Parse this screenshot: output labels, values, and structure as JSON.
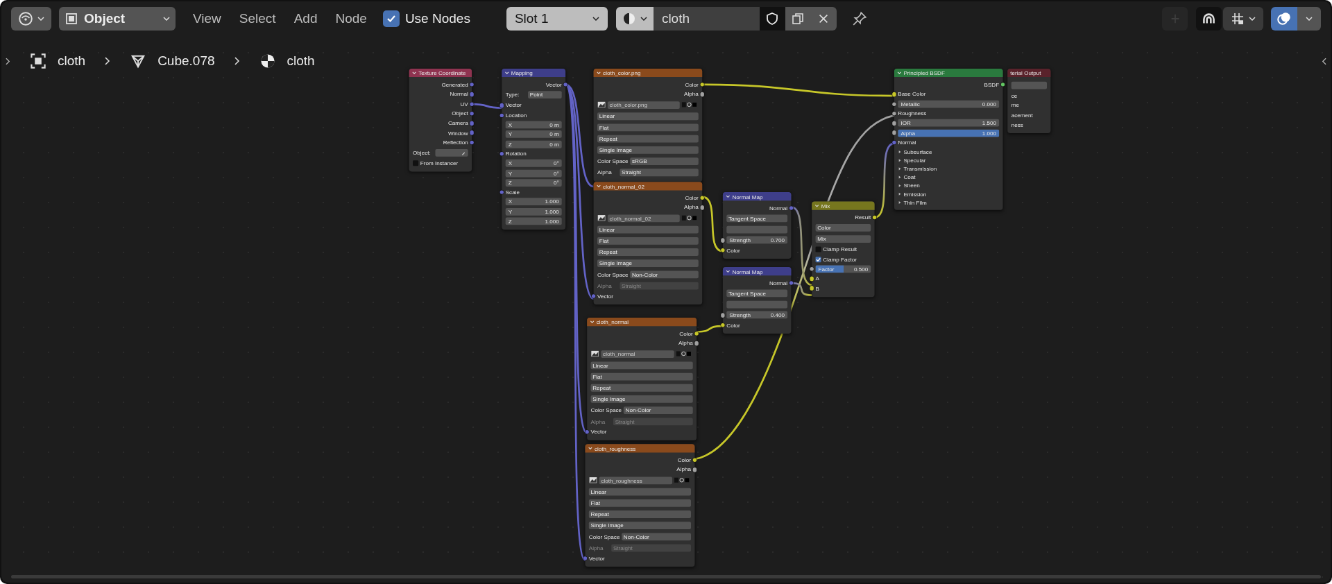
{
  "header": {
    "mode": "Object",
    "menus": [
      "View",
      "Select",
      "Add",
      "Node"
    ],
    "use_nodes": {
      "label": "Use Nodes",
      "checked": true
    },
    "slot": "Slot 1",
    "material": "cloth",
    "overlays_on": true
  },
  "breadcrumbs": [
    {
      "kind": "object",
      "label": "cloth"
    },
    {
      "kind": "mesh",
      "label": "Cube.078"
    },
    {
      "kind": "material",
      "label": "cloth"
    }
  ],
  "nodes": [
    {
      "kind": "input",
      "title": "Texture Coordinate",
      "rows": [
        {
          "kind": "out",
          "label": "Generated",
          "color": "#6363c7"
        },
        {
          "kind": "out",
          "label": "Normal",
          "color": "#6363c7"
        },
        {
          "kind": "out",
          "label": "UV",
          "color": "#6363c7"
        },
        {
          "kind": "out",
          "label": "Object",
          "color": "#6363c7"
        },
        {
          "kind": "out",
          "label": "Camera",
          "color": "#6363c7"
        },
        {
          "kind": "out",
          "label": "Window",
          "color": "#6363c7"
        },
        {
          "kind": "out",
          "label": "Reflection",
          "color": "#6363c7"
        },
        {
          "kind": "object",
          "label": "Object:"
        },
        {
          "kind": "check",
          "label": "From Instancer",
          "checked": false
        }
      ]
    },
    {
      "kind": "vector",
      "title": "Mapping",
      "rows": [
        {
          "kind": "out",
          "label": "Vector",
          "color": "#6363c7"
        },
        {
          "kind": "labeled-select",
          "label": "Type:",
          "value": "Point",
          "disabled": false
        },
        {
          "kind": "in",
          "label": "Vector",
          "color": "#6363c7"
        },
        {
          "kind": "in",
          "label": "Location",
          "color": "#6363c7"
        },
        {
          "kind": "num",
          "label": "X",
          "value": "0 m"
        },
        {
          "kind": "num",
          "label": "Y",
          "value": "0 m"
        },
        {
          "kind": "num",
          "label": "Z",
          "value": "0 m"
        },
        {
          "kind": "in",
          "label": "Rotation",
          "color": "#6363c7"
        },
        {
          "kind": "num",
          "label": "X",
          "value": "0°"
        },
        {
          "kind": "num",
          "label": "Y",
          "value": "0°"
        },
        {
          "kind": "num",
          "label": "Z",
          "value": "0°"
        },
        {
          "kind": "in",
          "label": "Scale",
          "color": "#6363c7"
        },
        {
          "kind": "num",
          "label": "X",
          "value": "1.000"
        },
        {
          "kind": "num",
          "label": "Y",
          "value": "1.000"
        },
        {
          "kind": "num",
          "label": "Z",
          "value": "1.000"
        }
      ]
    },
    {
      "kind": "texture",
      "title": "cloth_color.png",
      "rows": [
        {
          "kind": "out",
          "label": "Color",
          "color": "#c7c729"
        },
        {
          "kind": "out",
          "label": "Alpha",
          "color": "#a1a1a1"
        },
        {
          "kind": "image",
          "value": "cloth_color.png"
        },
        {
          "kind": "select",
          "value": "Linear"
        },
        {
          "kind": "select",
          "value": "Flat"
        },
        {
          "kind": "select",
          "value": "Repeat"
        },
        {
          "kind": "select",
          "value": "Single Image"
        },
        {
          "kind": "labeled-select",
          "label": "Color Space",
          "value": "sRGB",
          "disabled": false
        },
        {
          "kind": "labeled-select",
          "label": "Alpha",
          "value": "Straight",
          "disabled": false
        }
      ]
    },
    {
      "kind": "texture",
      "title": "cloth_normal_02",
      "rows": [
        {
          "kind": "out",
          "label": "Color",
          "color": "#c7c729"
        },
        {
          "kind": "out",
          "label": "Alpha",
          "color": "#a1a1a1"
        },
        {
          "kind": "image",
          "value": "cloth_normal_02"
        },
        {
          "kind": "select",
          "value": "Linear"
        },
        {
          "kind": "select",
          "value": "Flat"
        },
        {
          "kind": "select",
          "value": "Repeat"
        },
        {
          "kind": "select",
          "value": "Single Image"
        },
        {
          "kind": "labeled-select",
          "label": "Color Space",
          "value": "Non-Color",
          "disabled": false
        },
        {
          "kind": "labeled-select",
          "label": "Alpha",
          "value": "Straight",
          "disabled": true
        },
        {
          "kind": "in",
          "label": "Vector",
          "color": "#6363c7"
        }
      ]
    },
    {
      "kind": "vector",
      "title": "Normal Map",
      "rows": [
        {
          "kind": "out",
          "label": "Normal",
          "color": "#6363c7"
        },
        {
          "kind": "select",
          "value": "Tangent Space"
        },
        {
          "kind": "uv-map"
        },
        {
          "kind": "num",
          "label": "Strength",
          "value": "0.700",
          "color": "#a1a1a1"
        },
        {
          "kind": "in",
          "label": "Color",
          "color": "#c7c729"
        }
      ]
    },
    {
      "kind": "vector",
      "title": "Normal Map",
      "rows": [
        {
          "kind": "out",
          "label": "Normal",
          "color": "#6363c7"
        },
        {
          "kind": "select",
          "value": "Tangent Space"
        },
        {
          "kind": "uv-map"
        },
        {
          "kind": "num",
          "label": "Strength",
          "value": "0.400",
          "color": "#a1a1a1"
        },
        {
          "kind": "in",
          "label": "Color",
          "color": "#c7c729"
        }
      ]
    },
    {
      "kind": "color",
      "title": "Mix",
      "rows": [
        {
          "kind": "out",
          "label": "Result",
          "color": "#c7c729"
        },
        {
          "kind": "select",
          "value": "Color"
        },
        {
          "kind": "select",
          "value": "Mix"
        },
        {
          "kind": "check",
          "label": "Clamp Result",
          "checked": false
        },
        {
          "kind": "check",
          "label": "Clamp Factor",
          "checked": true
        },
        {
          "kind": "slider",
          "label": "Factor",
          "value": "0.500",
          "level": 0.5,
          "color": "#a1a1a1"
        },
        {
          "kind": "in",
          "label": "A",
          "color": "#c7c729"
        },
        {
          "kind": "in",
          "label": "B",
          "color": "#c7c729"
        }
      ]
    },
    {
      "kind": "shader",
      "title": "Principled BSDF",
      "rows": [
        {
          "kind": "out",
          "label": "BSDF",
          "color": "#63c763"
        },
        {
          "kind": "in",
          "label": "Base Color",
          "color": "#c7c729"
        },
        {
          "kind": "num",
          "label": "Metallic",
          "value": "0.000",
          "color": "#a1a1a1"
        },
        {
          "kind": "in",
          "label": "Roughness",
          "color": "#a1a1a1"
        },
        {
          "kind": "num",
          "label": "IOR",
          "value": "1.500",
          "color": "#a1a1a1"
        },
        {
          "kind": "slider",
          "label": "Alpha",
          "value": "1.000",
          "level": 1,
          "color": "#a1a1a1"
        },
        {
          "kind": "in",
          "label": "Normal",
          "color": "#6363c7"
        },
        {
          "kind": "panel",
          "label": "Subsurface"
        },
        {
          "kind": "panel",
          "label": "Specular"
        },
        {
          "kind": "panel",
          "label": "Transmission"
        },
        {
          "kind": "panel",
          "label": "Coat"
        },
        {
          "kind": "panel",
          "label": "Sheen"
        },
        {
          "kind": "panel",
          "label": "Emission"
        },
        {
          "kind": "panel",
          "label": "Thin Film"
        }
      ]
    },
    {
      "kind": "output",
      "title": "terial Output",
      "rows": [
        {
          "kind": "blank-select"
        },
        {
          "kind": "cut",
          "label": "ce"
        },
        {
          "kind": "cut",
          "label": "me"
        },
        {
          "kind": "cut",
          "label": "acement"
        },
        {
          "kind": "cut",
          "label": "ness"
        }
      ]
    },
    {
      "kind": "texture",
      "title": "cloth_normal",
      "rows": [
        {
          "kind": "out",
          "label": "Color",
          "color": "#c7c729"
        },
        {
          "kind": "out",
          "label": "Alpha",
          "color": "#a1a1a1"
        },
        {
          "kind": "image",
          "value": "cloth_normal"
        },
        {
          "kind": "select",
          "value": "Linear"
        },
        {
          "kind": "select",
          "value": "Flat"
        },
        {
          "kind": "select",
          "value": "Repeat"
        },
        {
          "kind": "select",
          "value": "Single Image"
        },
        {
          "kind": "labeled-select",
          "label": "Color Space",
          "value": "Non-Color",
          "disabled": false
        },
        {
          "kind": "labeled-select",
          "label": "Alpha",
          "value": "Straight",
          "disabled": true
        },
        {
          "kind": "in",
          "label": "Vector",
          "color": "#6363c7"
        }
      ]
    },
    {
      "kind": "texture",
      "title": "cloth_roughness",
      "rows": [
        {
          "kind": "out",
          "label": "Color",
          "color": "#c7c729"
        },
        {
          "kind": "out",
          "label": "Alpha",
          "color": "#a1a1a1"
        },
        {
          "kind": "image",
          "value": "cloth_roughness"
        },
        {
          "kind": "select",
          "value": "Linear"
        },
        {
          "kind": "select",
          "value": "Flat"
        },
        {
          "kind": "select",
          "value": "Repeat"
        },
        {
          "kind": "select",
          "value": "Single Image"
        },
        {
          "kind": "labeled-select",
          "label": "Color Space",
          "value": "Non-Color",
          "disabled": false
        },
        {
          "kind": "labeled-select",
          "label": "Alpha",
          "value": "Straight",
          "disabled": true
        },
        {
          "kind": "in",
          "label": "Vector",
          "color": "#6363c7"
        }
      ]
    }
  ]
}
